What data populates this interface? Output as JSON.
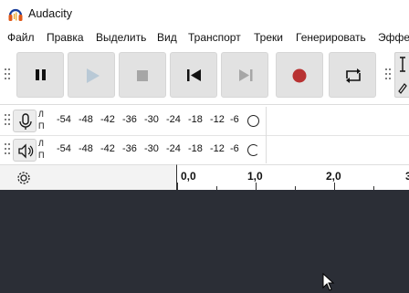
{
  "window": {
    "title": "Audacity",
    "icon": "audacity-headphones-icon"
  },
  "menu": {
    "items": [
      "Файл",
      "Правка",
      "Выделить",
      "Вид",
      "Транспорт",
      "Треки",
      "Генерировать",
      "Эффе"
    ]
  },
  "transport": {
    "buttons": [
      "pause-icon",
      "play-icon",
      "stop-icon",
      "skip-to-start-icon",
      "skip-to-end-icon",
      "record-icon",
      "loop-icon"
    ],
    "colors": {
      "record": "#b83232",
      "play_disabled": "#b9c9d6",
      "button_bg": "#e2e2e2"
    }
  },
  "meters": {
    "record": {
      "icon": "microphone-icon",
      "channels": [
        "Л",
        "П"
      ],
      "scale": [
        "-54",
        "-48",
        "-42",
        "-36",
        "-30",
        "-24",
        "-18",
        "-12",
        "-6"
      ]
    },
    "playback": {
      "icon": "speaker-icon",
      "channels": [
        "Л",
        "П"
      ],
      "scale": [
        "-54",
        "-48",
        "-42",
        "-36",
        "-30",
        "-24",
        "-18",
        "-12",
        "-6"
      ]
    }
  },
  "timeline": {
    "labels": [
      "0,0",
      "1,0",
      "2,0",
      "3"
    ],
    "settings_icon": "gear-icon"
  },
  "tracks": {
    "background": "#2b2e36"
  }
}
